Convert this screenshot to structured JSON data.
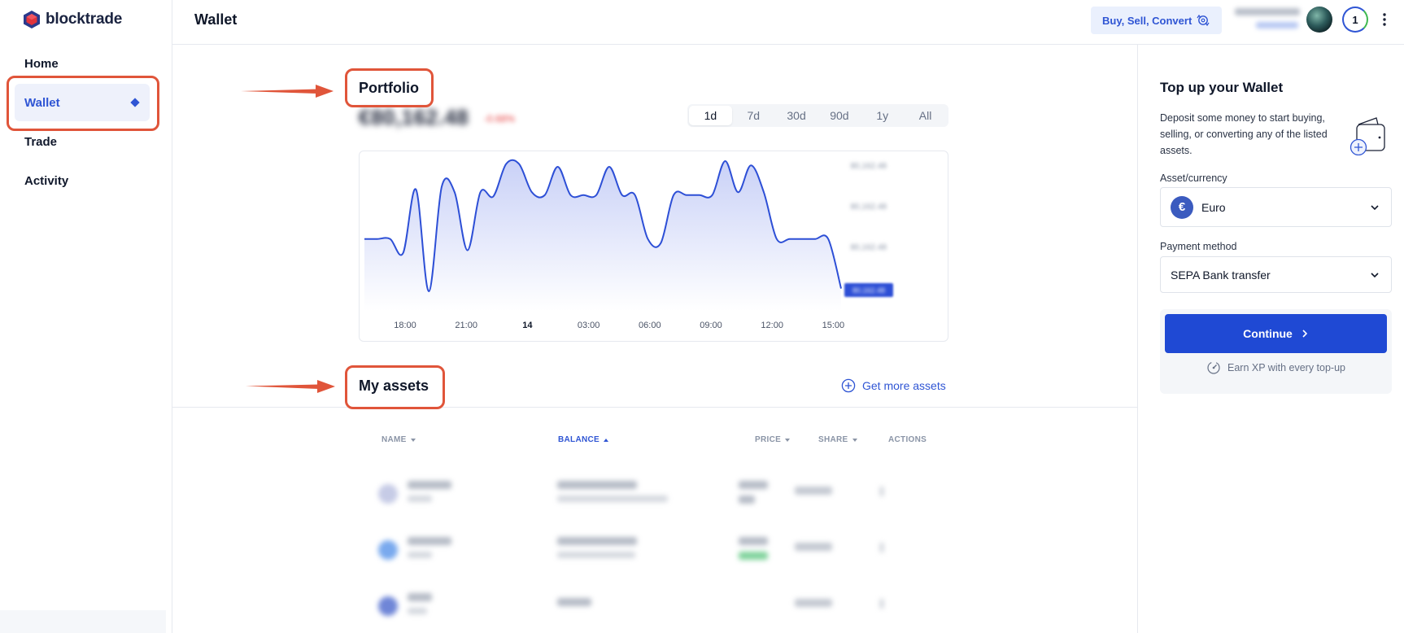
{
  "app": {
    "brand": "blocktrade"
  },
  "sidebar": {
    "items": [
      {
        "label": "Home"
      },
      {
        "label": "Wallet"
      },
      {
        "label": "Trade"
      },
      {
        "label": "Activity"
      }
    ],
    "active_item": "Wallet"
  },
  "header": {
    "title": "Wallet",
    "action_button": "Buy, Sell, Convert",
    "level_badge": "1"
  },
  "portfolio": {
    "title": "Portfolio",
    "value": "€80,162.48",
    "change": "-0.68%",
    "range_tabs": [
      "1d",
      "7d",
      "30d",
      "90d",
      "1y",
      "All"
    ],
    "active_range": "1d"
  },
  "chart_data": {
    "type": "area",
    "title": "",
    "xlabel": "",
    "ylabel": "",
    "x_tick_labels": [
      "18:00",
      "21:00",
      "14",
      "03:00",
      "06:00",
      "09:00",
      "12:00",
      "15:00"
    ],
    "emphasized_tick": "14",
    "y_tick_labels": [
      "80,162.48",
      "80,162.48",
      "80,162.48"
    ],
    "current_value_label": "80,162.48",
    "series_shape_note": "values obscured; relative curve heights below (0 = bottom, 1 = top)",
    "values": [
      0.45,
      0.45,
      0.45,
      0.35,
      0.8,
      0.08,
      0.82,
      0.78,
      0.37,
      0.78,
      0.75,
      0.98,
      0.98,
      0.78,
      0.76,
      0.96,
      0.76,
      0.76,
      0.76,
      0.96,
      0.76,
      0.76,
      0.45,
      0.42,
      0.76,
      0.76,
      0.76,
      0.76,
      1.0,
      0.78,
      0.97,
      0.78,
      0.45,
      0.45,
      0.45,
      0.45,
      0.45,
      0.1
    ],
    "colors": {
      "line": "#2d4fd6",
      "fill_top": "#c9d1f7",
      "fill_bottom": "#ffffff",
      "marker": "#2d4fd6"
    },
    "grid": false
  },
  "assets": {
    "title": "My assets",
    "get_more": "Get more assets",
    "columns": [
      {
        "label": "NAME",
        "sorted": false
      },
      {
        "label": "BALANCE",
        "sorted": true
      },
      {
        "label": "PRICE",
        "sorted": false
      },
      {
        "label": "SHARE",
        "sorted": false
      },
      {
        "label": "ACTIONS",
        "sorted": false
      }
    ],
    "rows": [
      {
        "coin_color": "#c6cbe6",
        "price_change": "neutral"
      },
      {
        "coin_color": "#79a9ee",
        "price_change": "up"
      },
      {
        "coin_color": "#6f86d7",
        "price_change": "none"
      }
    ]
  },
  "topup": {
    "title": "Top up your Wallet",
    "description": "Deposit some money to start buying, selling, or converting any of the listed assets.",
    "asset_label": "Asset/currency",
    "asset_symbol": "€",
    "asset_value": "Euro",
    "payment_label": "Payment method",
    "payment_value": "SEPA Bank transfer",
    "continue": "Continue",
    "earn_xp": "Earn XP with every top-up"
  },
  "colors": {
    "accent": "#2f55d4",
    "annotation": "#e0553a",
    "primary_button": "#1f49d4"
  }
}
